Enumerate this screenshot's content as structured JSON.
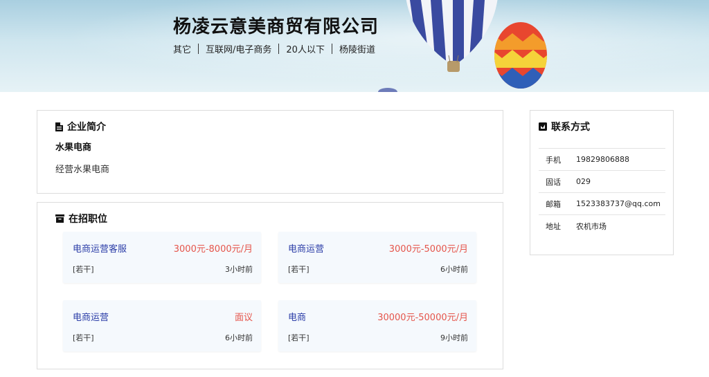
{
  "company": {
    "name": "杨凌云意美商贸有限公司",
    "meta": [
      "其它",
      "互联网/电子商务",
      "20人以下",
      "杨陵街道"
    ]
  },
  "intro": {
    "title": "企业简介",
    "subtitle": "水果电商",
    "description": "经营水果电商"
  },
  "jobs": {
    "title": "在招职位",
    "items": [
      {
        "title": "电商运营客服",
        "salary": "3000元-8000元/月",
        "count": "[若干]",
        "time": "3小时前"
      },
      {
        "title": "电商运营",
        "salary": "3000元-5000元/月",
        "count": "[若干]",
        "time": "6小时前"
      },
      {
        "title": "电商运营",
        "salary": "面议",
        "count": "[若干]",
        "time": "6小时前"
      },
      {
        "title": "电商",
        "salary": "30000元-50000元/月",
        "count": "[若干]",
        "time": "9小时前"
      }
    ]
  },
  "contact": {
    "title": "联系方式",
    "rows": [
      {
        "label": "手机",
        "value": "19829806888"
      },
      {
        "label": "固话",
        "value": "029"
      },
      {
        "label": "邮箱",
        "value": "1523383737@qq.com"
      },
      {
        "label": "地址",
        "value": "农机市场"
      }
    ]
  },
  "icons": {
    "intro": "document-icon",
    "jobs": "archive-icon",
    "contact": "contact-card-icon"
  },
  "colors": {
    "job_title": "#2c3ea8",
    "salary": "#e5544a"
  }
}
